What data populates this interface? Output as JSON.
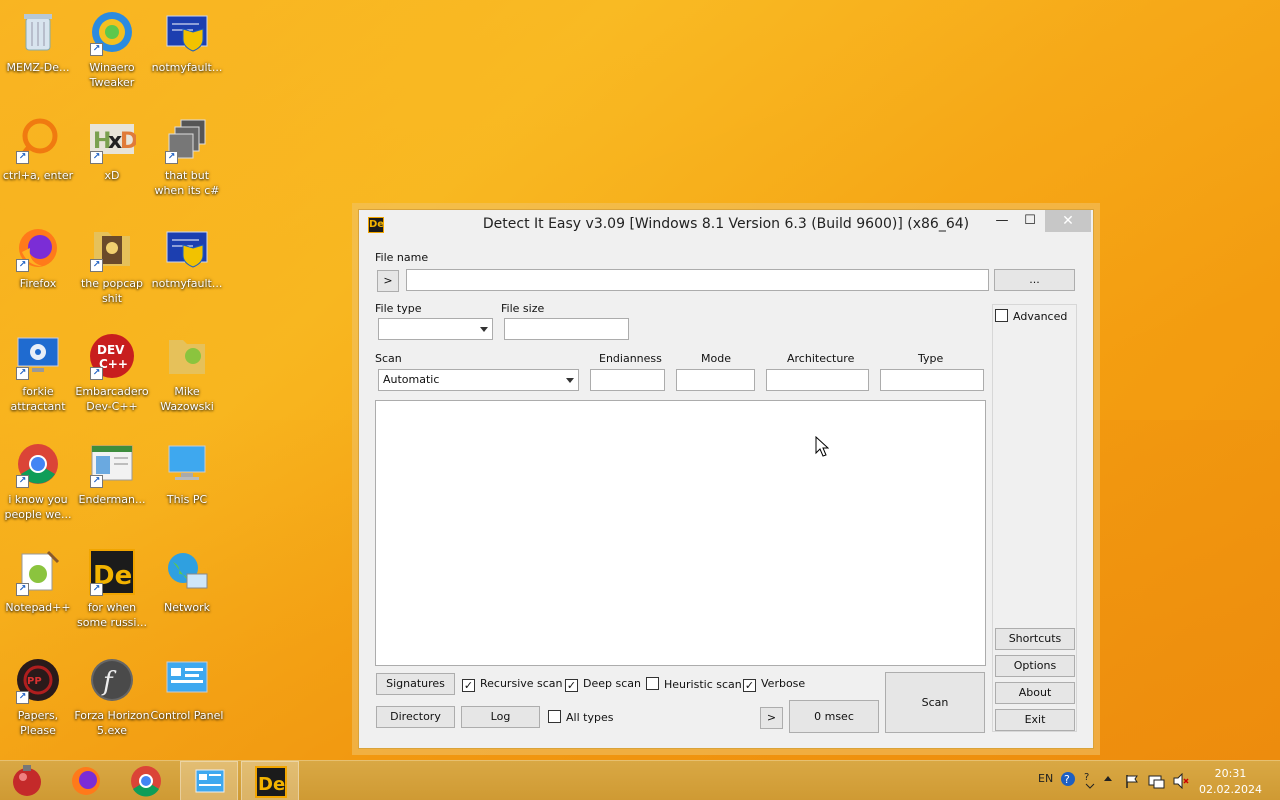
{
  "desktop": {
    "icons": [
      {
        "label": "MEMZ-De..."
      },
      {
        "label": "Winaero Tweaker"
      },
      {
        "label": "notmyfault..."
      },
      {
        "label": "ctrl+a, enter"
      },
      {
        "label": "xD"
      },
      {
        "label": "that but when its c#"
      },
      {
        "label": "Firefox"
      },
      {
        "label": "the popcap shit"
      },
      {
        "label": "notmyfault..."
      },
      {
        "label": "forkie attractant"
      },
      {
        "label": "Embarcadero Dev-C++"
      },
      {
        "label": "Mike Wazowski"
      },
      {
        "label": "i know you people we..."
      },
      {
        "label": "Enderman..."
      },
      {
        "label": "This PC"
      },
      {
        "label": "Notepad++"
      },
      {
        "label": "for when some russi..."
      },
      {
        "label": "Network"
      },
      {
        "label": "Papers, Please"
      },
      {
        "label": "Forza Horizon 5.exe"
      },
      {
        "label": "Control Panel"
      }
    ]
  },
  "window": {
    "title": "Detect It Easy v3.09 [Windows 8.1 Version 6.3 (Build 9600)] (x86_64)",
    "app_icon_text": "De",
    "minimize": "—",
    "maximize": "☐",
    "close": "✕",
    "file_name_label": "File name",
    "file_name_value": "",
    "expand_btn": ">",
    "browse_btn": "...",
    "file_type_label": "File type",
    "file_type_value": "",
    "file_size_label": "File size",
    "file_size_value": "",
    "scan_label": "Scan",
    "scan_value": "Automatic",
    "endianness_label": "Endianness",
    "mode_label": "Mode",
    "architecture_label": "Architecture",
    "type_label": "Type",
    "advanced_label": "Advanced",
    "shortcuts_btn": "Shortcuts",
    "options_btn": "Options",
    "about_btn": "About",
    "exit_btn": "Exit",
    "signatures_btn": "Signatures",
    "recursive_label": "Recursive scan",
    "deep_label": "Deep scan",
    "heuristic_label": "Heuristic scan",
    "verbose_label": "Verbose",
    "directory_btn": "Directory",
    "log_btn": "Log",
    "all_types_label": "All types",
    "arrow_btn": ">",
    "time_value": "0 msec",
    "scan_btn": "Scan",
    "check_mark": "✓"
  },
  "taskbar": {
    "lang": "EN",
    "time": "20:31",
    "date": "02.02.2024"
  }
}
